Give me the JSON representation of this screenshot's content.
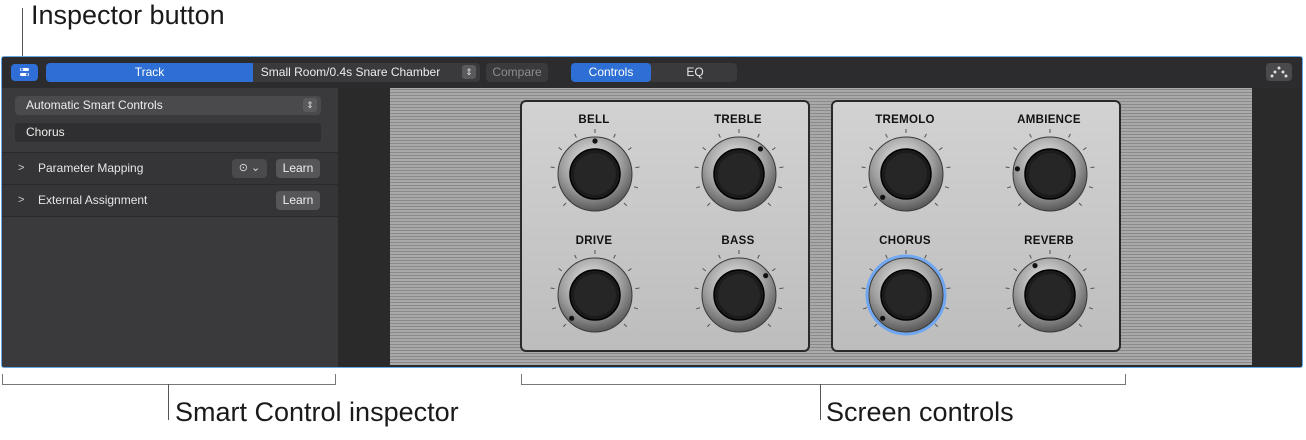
{
  "callouts": {
    "inspector_button": "Inspector button",
    "smart_control_inspector": "Smart Control inspector",
    "screen_controls": "Screen controls"
  },
  "toolbar": {
    "track_label": "Track",
    "patch_name": "Small Room/0.4s Snare Chamber",
    "compare_label": "Compare",
    "tabs": [
      {
        "label": "Controls",
        "active": true
      },
      {
        "label": "EQ",
        "active": false
      }
    ]
  },
  "inspector": {
    "layout_select": "Automatic Smart Controls",
    "selected_control_name": "Chorus",
    "sections": [
      {
        "label": "Parameter Mapping",
        "button": "Learn"
      },
      {
        "label": "External Assignment",
        "button": "Learn"
      }
    ]
  },
  "screen_controls": {
    "knobs": [
      {
        "label": "BELL",
        "value": 0.5
      },
      {
        "label": "TREBLE",
        "value": 0.65
      },
      {
        "label": "DRIVE",
        "value": 0.0
      },
      {
        "label": "BASS",
        "value": 0.7
      },
      {
        "label": "TREMOLO",
        "value": 0.0
      },
      {
        "label": "AMBIENCE",
        "value": 0.2
      },
      {
        "label": "CHORUS",
        "value": 0.0,
        "selected": true
      },
      {
        "label": "REVERB",
        "value": 0.4
      }
    ]
  },
  "colors": {
    "accent": "#2d6fd4",
    "selected_ring": "#5aa0ff"
  }
}
